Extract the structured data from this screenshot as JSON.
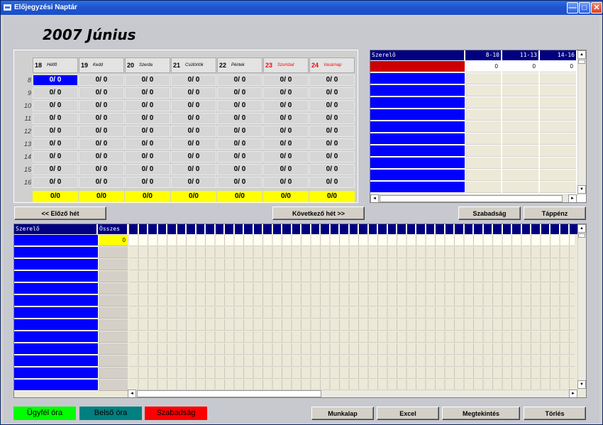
{
  "window": {
    "title": "Előjegyzési Naptár"
  },
  "month_title": "2007 Június",
  "days": [
    {
      "num": "18",
      "name": "Hétfő",
      "weekend": false
    },
    {
      "num": "19",
      "name": "Kedd",
      "weekend": false
    },
    {
      "num": "20",
      "name": "Szerda",
      "weekend": false
    },
    {
      "num": "21",
      "name": "Csütörtök",
      "weekend": false
    },
    {
      "num": "22",
      "name": "Péntek",
      "weekend": false
    },
    {
      "num": "23",
      "name": "Szombat",
      "weekend": true
    },
    {
      "num": "24",
      "name": "Vasárnap",
      "weekend": true
    }
  ],
  "hours": [
    "8",
    "9",
    "10",
    "11",
    "12",
    "13",
    "14",
    "15",
    "16"
  ],
  "cell_value": "0/ 0",
  "total_value": "0/0",
  "nav": {
    "prev": "<< Előző hét",
    "next": "Következő hét >>",
    "vacation": "Szabadság",
    "sick": "Táppénz"
  },
  "right_panel": {
    "header": "Szerelő",
    "slots": [
      "8-10",
      "11-13",
      "14-16"
    ],
    "first_row_values": [
      "0",
      "0",
      "0"
    ]
  },
  "bottom_grid": {
    "header": "Szerelő",
    "total_header": "Összes",
    "first_total": "0"
  },
  "legend": [
    {
      "label": "Ügyfél óra",
      "bg": "#00ff00",
      "fg": "#000000"
    },
    {
      "label": "Belső óra",
      "bg": "#008080",
      "fg": "#000000"
    },
    {
      "label": "Szabadság",
      "bg": "#ff0000",
      "fg": "#000000"
    }
  ],
  "actions": {
    "worksheet": "Munkalap",
    "excel": "Excel",
    "view": "Megtekintés",
    "delete": "Törlés"
  },
  "colors": {
    "selected": "#0000ff",
    "total": "#ffff00",
    "header": "#000080",
    "weekend": "#ff0000"
  }
}
